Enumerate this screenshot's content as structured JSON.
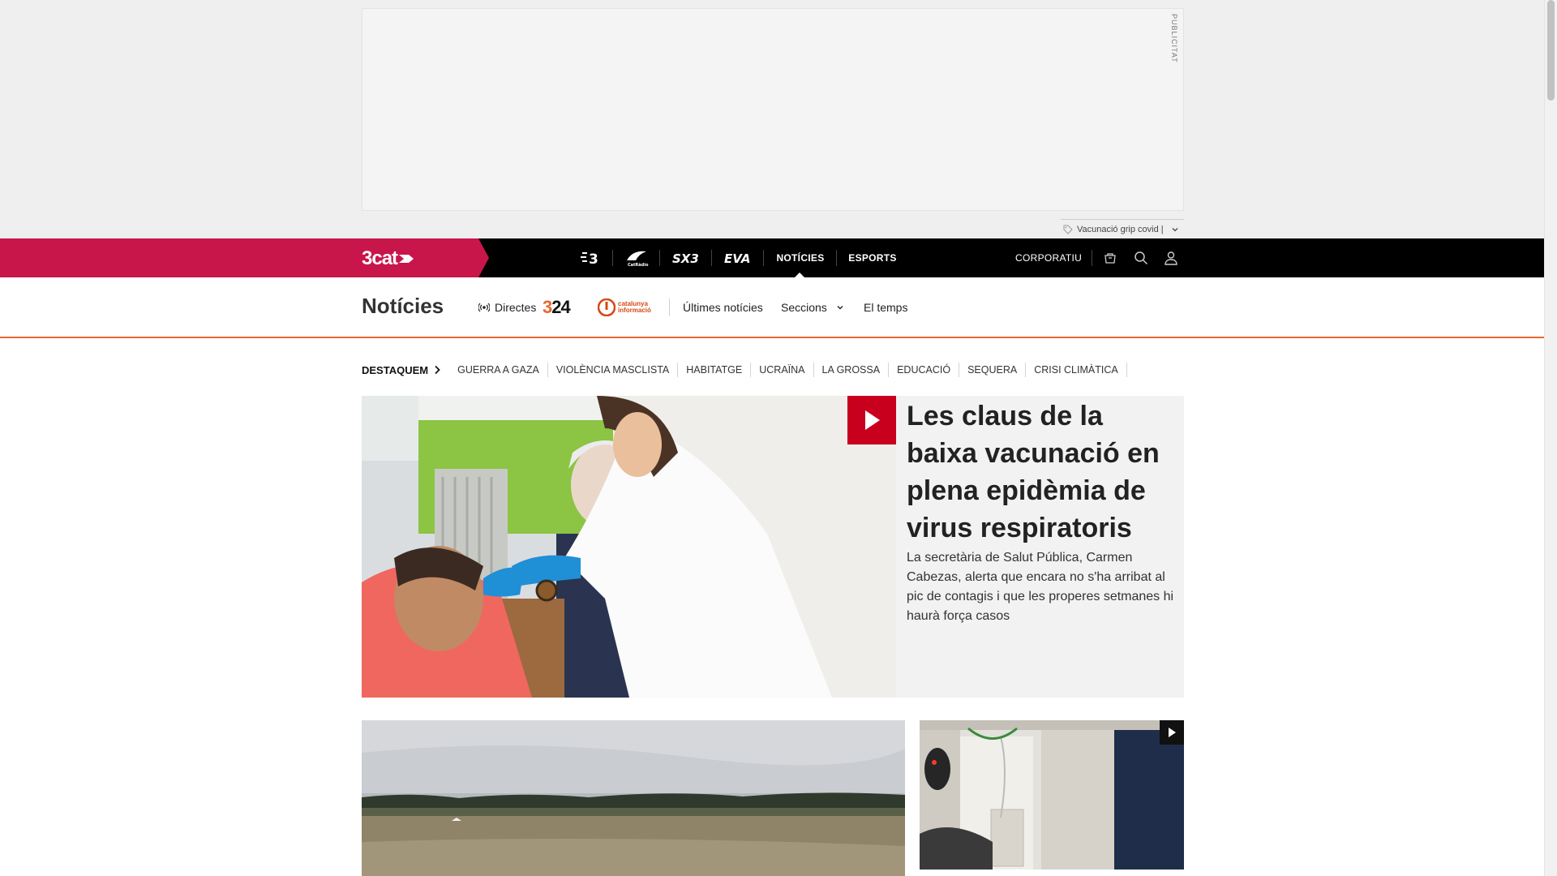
{
  "ad": {
    "label": "PUBLICITAT"
  },
  "tag_chip": {
    "text": "Vacunació grip covid |"
  },
  "topbar": {
    "brand": "3cat",
    "channels": [
      {
        "id": "tv3",
        "label": "3"
      },
      {
        "id": "catradio",
        "label": "CatRàdio"
      },
      {
        "id": "sx3",
        "label": "SX3"
      },
      {
        "id": "eva",
        "label": "EVA"
      }
    ],
    "nav": [
      {
        "label": "NOTÍCIES",
        "active": true
      },
      {
        "label": "ESPORTS",
        "active": false
      }
    ],
    "corporate": "CORPORATIU",
    "icons": [
      "shop-icon",
      "search-icon",
      "user-icon"
    ]
  },
  "section": {
    "title": "Notícies",
    "live_label": "Directes",
    "live_logo_1": "324",
    "live_logo_2_line1": "catalunya",
    "live_logo_2_line2": "informació",
    "links": [
      "Últimes notícies",
      "Seccions",
      "El temps"
    ]
  },
  "highlights": {
    "head": "DESTAQUEM",
    "items": [
      "GUERRA A GAZA",
      "VIOLÈNCIA MASCLISTA",
      "HABITATGE",
      "UCRAÏNA",
      "LA GROSSA",
      "EDUCACIÓ",
      "SEQUERA",
      "CRISI CLIMÀTICA"
    ]
  },
  "featured": {
    "title": "Les claus de la baixa vacunació en plena epidèmia de virus respiratoris",
    "summary": "La secretària de Salut Pública, Carmen Cabezas, alerta que encara no s'ha arribat al pic de contagis i que les properes setmanes hi haurà força casos",
    "has_video": true
  },
  "cards": [
    {
      "id": "card-1",
      "has_video": false
    },
    {
      "id": "card-2",
      "has_video": true
    }
  ],
  "colors": {
    "brand": "#c8164a",
    "accent": "#e8672c",
    "play": "#c8001d"
  }
}
